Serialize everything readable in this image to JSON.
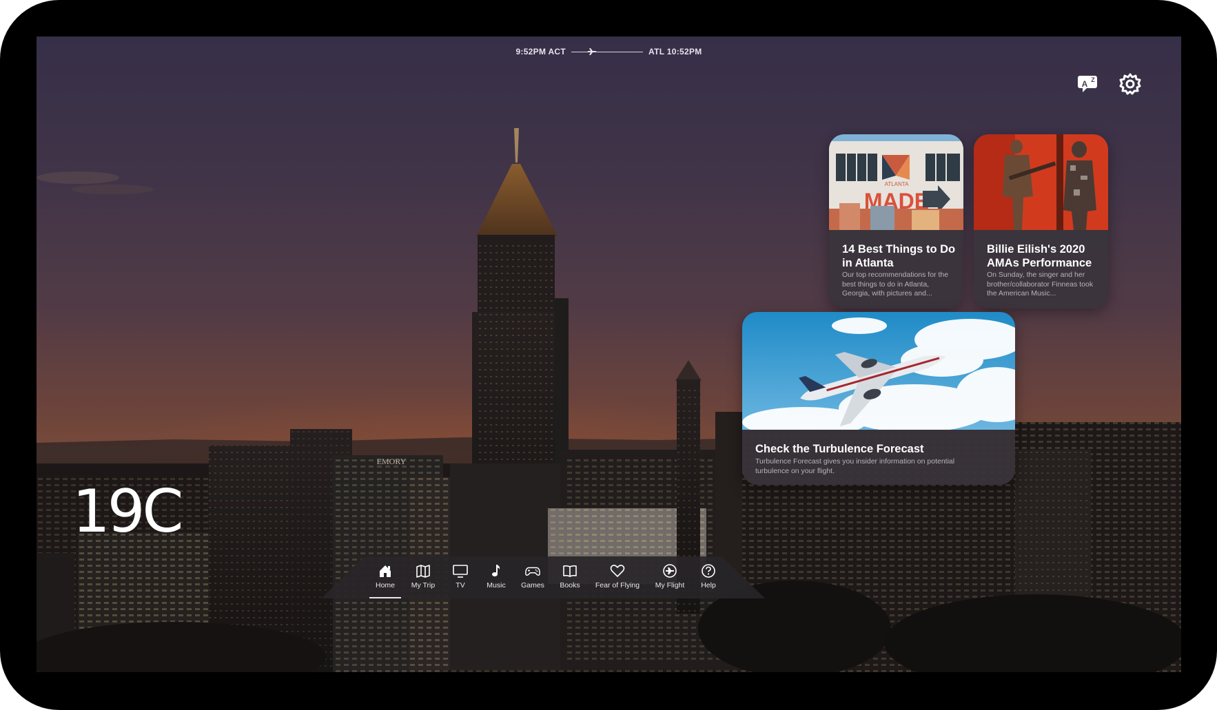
{
  "flight": {
    "origin_time": "9:52PM ACT",
    "destination_time": "ATL 10:52PM"
  },
  "weather": {
    "temperature": "19C"
  },
  "cards": [
    {
      "id": "atlanta",
      "title": "14 Best Things to Do in Atlanta",
      "description": "Our top recommendations for the best things to do in Atlanta, Georgia, with pictures and...",
      "image_label_small": "ATLANTA",
      "image_label_big": "MADE"
    },
    {
      "id": "billie",
      "title": "Billie Eilish's 2020 AMAs Performance",
      "description": "On Sunday, the singer and her brother/collaborator Finneas took the American Music..."
    },
    {
      "id": "turbulence",
      "title": "Check the Turbulence Forecast",
      "description": "Turbulence Forecast gives you insider information on potential turbulence on your flight."
    }
  ],
  "skyline": {
    "building_sign": "EMORY"
  },
  "nav": {
    "items": [
      {
        "label": "Home",
        "icon": "home-icon"
      },
      {
        "label": "My Trip",
        "icon": "map-icon"
      },
      {
        "label": "TV",
        "icon": "tv-icon"
      },
      {
        "label": "Music",
        "icon": "music-note-icon"
      },
      {
        "label": "Games",
        "icon": "gamepad-icon"
      },
      {
        "label": "Books",
        "icon": "book-icon"
      },
      {
        "label": "Fear of Flying",
        "icon": "heart-icon"
      },
      {
        "label": "My Flight",
        "icon": "plane-circle-icon"
      },
      {
        "label": "Help",
        "icon": "help-icon"
      }
    ],
    "active": "Home"
  },
  "colors": {
    "card_bg": "#3a343c",
    "accent": "#e9e6ec"
  }
}
